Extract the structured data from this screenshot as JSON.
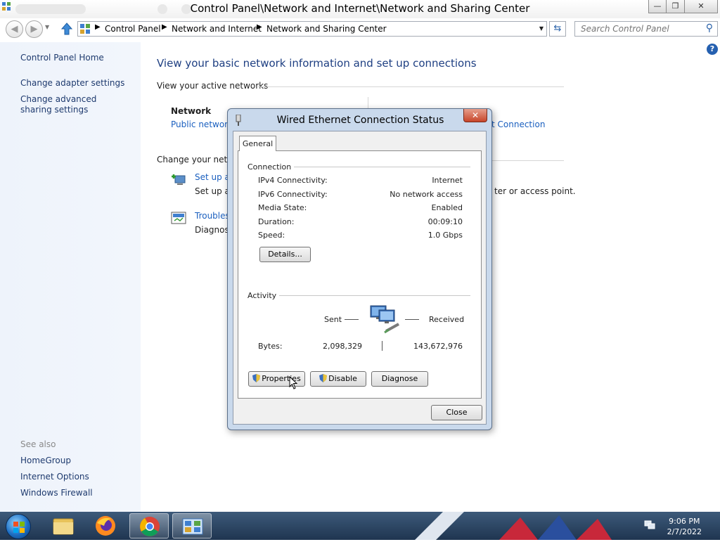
{
  "window": {
    "title": "Control Panel\\Network and Internet\\Network and Sharing Center",
    "minimize_glyph": "—",
    "restore_glyph": "❐",
    "close_glyph": "✕"
  },
  "nav": {
    "breadcrumbs": [
      "Control Panel",
      "Network and Internet",
      "Network and Sharing Center"
    ],
    "search_placeholder": "Search Control Panel"
  },
  "sidebar": {
    "items": [
      {
        "label": "Control Panel Home"
      },
      {
        "label": "Change adapter settings"
      },
      {
        "label": "Change advanced sharing settings"
      }
    ],
    "see_also_label": "See also",
    "see_also": [
      {
        "label": "HomeGroup"
      },
      {
        "label": "Internet Options"
      },
      {
        "label": "Windows Firewall"
      }
    ]
  },
  "main": {
    "heading": "View your basic network information and set up connections",
    "active_networks_label": "View your active networks",
    "network_name": "Network",
    "network_type": "Public network",
    "connection_link_fragment": "t Connection",
    "change_settings_label": "Change your netw",
    "tasks": [
      {
        "link": "Set up a",
        "desc": "Set up a",
        "desc_right": "ter or access point."
      },
      {
        "link": "Troubles",
        "desc": "Diagnose"
      }
    ]
  },
  "dialog": {
    "title": "Wired Ethernet Connection Status",
    "tab": "General",
    "connection_group": "Connection",
    "rows": [
      {
        "label": "IPv4 Connectivity:",
        "value": "Internet"
      },
      {
        "label": "IPv6 Connectivity:",
        "value": "No network access"
      },
      {
        "label": "Media State:",
        "value": "Enabled"
      },
      {
        "label": "Duration:",
        "value": "00:09:10"
      },
      {
        "label": "Speed:",
        "value": "1.0 Gbps"
      }
    ],
    "details_button": "Details...",
    "activity_group": "Activity",
    "sent_label": "Sent",
    "received_label": "Received",
    "bytes_label": "Bytes:",
    "bytes_sent": "2,098,329",
    "bytes_received": "143,672,976",
    "properties_button": "Properties",
    "disable_button": "Disable",
    "diagnose_button": "Diagnose",
    "close_button": "Close"
  },
  "taskbar": {
    "time": "9:06 PM",
    "date": "2/7/2022"
  }
}
